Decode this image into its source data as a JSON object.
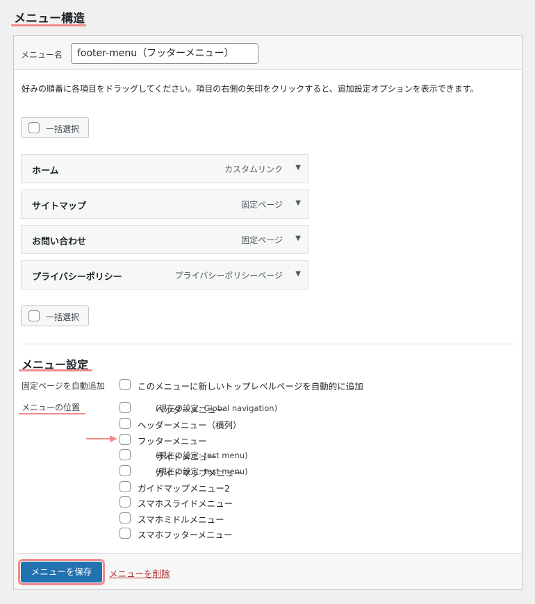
{
  "page": {
    "title": "メニュー構造"
  },
  "name_bar": {
    "label": "メニュー名",
    "value": "footer-menu（フッターメニュー）"
  },
  "instructions": "好みの順番に各項目をドラッグしてください。項目の右側の矢印をクリックすると、追加設定オプションを表示できます。",
  "bulk_select_label": "一括選択",
  "menu_items": [
    {
      "title": "ホーム",
      "type": "カスタムリンク"
    },
    {
      "title": "サイトマップ",
      "type": "固定ページ"
    },
    {
      "title": "お問い合わせ",
      "type": "固定ページ"
    },
    {
      "title": "プライバシーポリシー",
      "type": "プライバシーポリシーページ"
    }
  ],
  "settings": {
    "title": "メニュー設定",
    "auto_add_label": "固定ページを自動追加",
    "auto_add_option": "このメニューに新しいトップレベルページを自動的に追加",
    "locations_label": "メニューの位置",
    "locations": [
      {
        "name": "ヘッダーメニュー",
        "note": "(現在の設定: Global navigation)"
      },
      {
        "name": "ヘッダーメニュー（横列）",
        "note": ""
      },
      {
        "name": "フッターメニュー",
        "note": ""
      },
      {
        "name": "サイドメニュー",
        "note": "(現在の設定: test menu)"
      },
      {
        "name": "ガイドマップメニュー",
        "note": "(現在の設定: test menu)"
      },
      {
        "name": "ガイドマップメニュー2",
        "note": ""
      },
      {
        "name": "スマホスライドメニュー",
        "note": ""
      },
      {
        "name": "スマホミドルメニュー",
        "note": ""
      },
      {
        "name": "スマホフッターメニュー",
        "note": ""
      }
    ]
  },
  "footer": {
    "save_label": "メニューを保存",
    "delete_label": "メニューを削除"
  },
  "colors": {
    "accent": "#2271b1",
    "highlight": "#f48a8a",
    "delete": "#b32d2e"
  }
}
